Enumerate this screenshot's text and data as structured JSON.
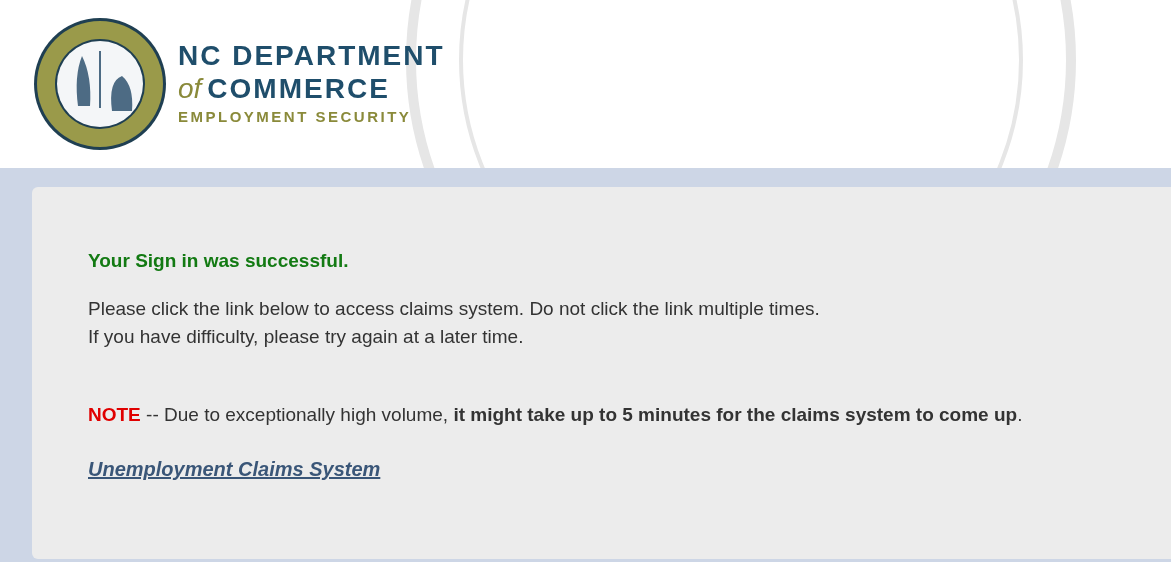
{
  "header": {
    "logo": {
      "line_1": "NC DEPARTMENT",
      "line_2_prefix": "of",
      "line_2": "COMMERCE",
      "line_3": "EMPLOYMENT SECURITY"
    }
  },
  "message": {
    "title": "Your Sign in was successful.",
    "paragraph": [
      "Please click the link below to access claims system. Do not click the link multiple times.",
      "If you have difficulty, please try again at a later time."
    ],
    "note_label": "NOTE",
    "note_text": " -- Due to exceptionally high volume, **it might take up to 5 minutes for the claims system to come up**.",
    "link": "Unemployment Claims System"
  }
}
